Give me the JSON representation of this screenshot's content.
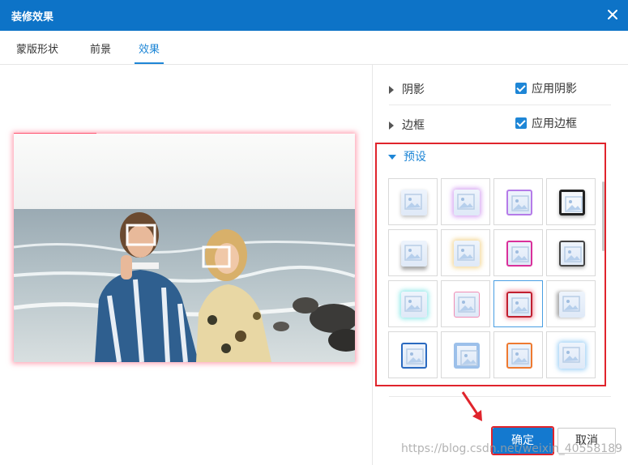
{
  "dialog": {
    "title": "装修效果",
    "close_icon": "close-icon"
  },
  "tabs": [
    {
      "label": "蒙版形状",
      "active": false
    },
    {
      "label": "前景",
      "active": false
    },
    {
      "label": "效果",
      "active": true
    }
  ],
  "panel": {
    "shadow_label": "阴影",
    "shadow_checkbox": "应用阴影",
    "border_label": "边框",
    "border_checkbox": "应用边框",
    "preset_label": "预设"
  },
  "presets": [
    {
      "style": "shadow-soft",
      "selected": false
    },
    {
      "style": "glow-purple",
      "selected": false
    },
    {
      "style": "gradient-purple",
      "selected": false
    },
    {
      "style": "dark-frame",
      "selected": false
    },
    {
      "style": "shadow-bottom",
      "selected": false
    },
    {
      "style": "glow-yellow",
      "selected": false
    },
    {
      "style": "gradient-pink",
      "selected": false
    },
    {
      "style": "dark-gray-frame",
      "selected": false
    },
    {
      "style": "glow-cyan",
      "selected": false
    },
    {
      "style": "pink-frame",
      "selected": false
    },
    {
      "style": "red-glow",
      "selected": true
    },
    {
      "style": "gray-shadow",
      "selected": false
    },
    {
      "style": "blue-frame",
      "selected": false
    },
    {
      "style": "thick-blue-frame",
      "selected": false
    },
    {
      "style": "orange-frame",
      "selected": false
    },
    {
      "style": "blue-glow",
      "selected": false
    }
  ],
  "buttons": {
    "ok": "确定",
    "cancel": "取消"
  },
  "watermark": "https://blog.csdn.net/weixin_40558189",
  "colors": {
    "titlebar": "#0d73c7",
    "accent": "#1e86d6",
    "highlight": "#e0242c"
  }
}
